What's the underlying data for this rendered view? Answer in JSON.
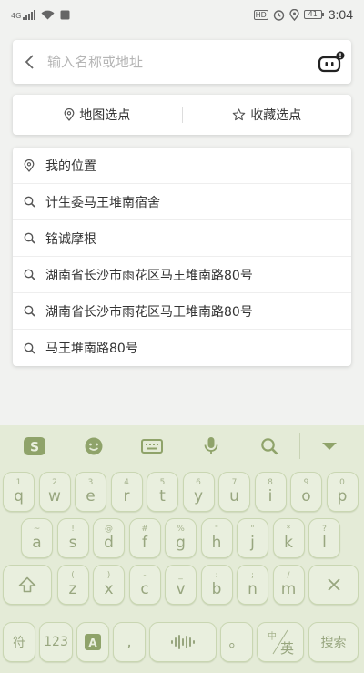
{
  "status_bar": {
    "time": "3:04",
    "hd_label": "HD",
    "battery_level": "41",
    "network_label": "4G"
  },
  "search": {
    "placeholder": "输入名称或地址",
    "back_icon": "chevron-left-icon",
    "assistant_icon": "robot-icon"
  },
  "pick": {
    "map_label": "地图选点",
    "fav_label": "收藏选点"
  },
  "suggestions": [
    {
      "icon": "location-pin-icon",
      "label": "我的位置"
    },
    {
      "icon": "search-icon",
      "label": "计生委马王堆南宿舍"
    },
    {
      "icon": "search-icon",
      "label": "铭诚摩根"
    },
    {
      "icon": "search-icon",
      "label": "湖南省长沙市雨花区马王堆南路80号"
    },
    {
      "icon": "search-icon",
      "label": "湖南省长沙市雨花区马王堆南路80号"
    },
    {
      "icon": "search-icon",
      "label": "马王堆南路80号"
    }
  ],
  "keyboard": {
    "colors": {
      "background": "#e4ebd7",
      "key": "#e9efde",
      "key_text": "#98a67f",
      "logo": "#8fa36a"
    },
    "toolbar_icons": [
      "sogou-logo-icon",
      "emoji-icon",
      "keyboard-icon",
      "microphone-icon",
      "search-icon",
      "collapse-icon"
    ],
    "row1": [
      {
        "main": "q",
        "sub": "1"
      },
      {
        "main": "w",
        "sub": "2"
      },
      {
        "main": "e",
        "sub": "3"
      },
      {
        "main": "r",
        "sub": "4"
      },
      {
        "main": "t",
        "sub": "5"
      },
      {
        "main": "y",
        "sub": "6"
      },
      {
        "main": "u",
        "sub": "7"
      },
      {
        "main": "i",
        "sub": "8"
      },
      {
        "main": "o",
        "sub": "9"
      },
      {
        "main": "p",
        "sub": "0"
      }
    ],
    "row2": [
      {
        "main": "a",
        "sub": "~"
      },
      {
        "main": "s",
        "sub": "!"
      },
      {
        "main": "d",
        "sub": "@"
      },
      {
        "main": "f",
        "sub": "#"
      },
      {
        "main": "g",
        "sub": "%"
      },
      {
        "main": "h",
        "sub": "\""
      },
      {
        "main": "j",
        "sub": "\""
      },
      {
        "main": "k",
        "sub": "*"
      },
      {
        "main": "l",
        "sub": "?"
      }
    ],
    "row3": [
      {
        "main": "z",
        "sub": "("
      },
      {
        "main": "x",
        "sub": ")"
      },
      {
        "main": "c",
        "sub": "-"
      },
      {
        "main": "v",
        "sub": "_"
      },
      {
        "main": "b",
        "sub": ":"
      },
      {
        "main": "n",
        "sub": ";"
      },
      {
        "main": "m",
        "sub": "/"
      }
    ],
    "row4": {
      "symbol_label": "符",
      "number_label": "123",
      "comma_label": ",",
      "period_label": "。",
      "lang_top": "中",
      "lang_bottom": "英",
      "search_label": "搜索"
    }
  }
}
